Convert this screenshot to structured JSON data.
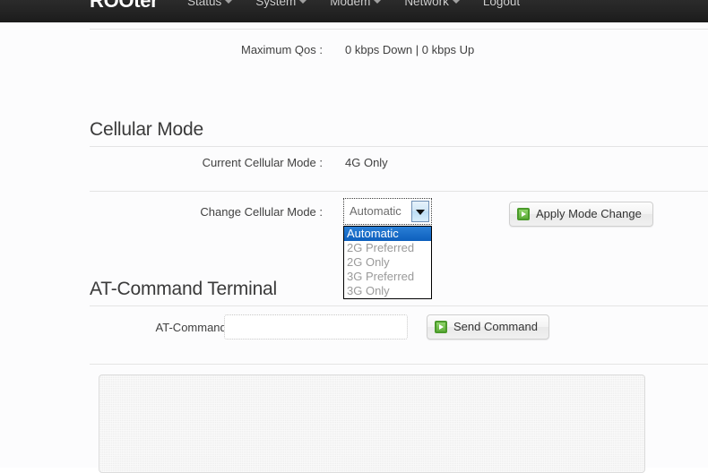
{
  "navbar": {
    "brand": "ROOter",
    "items": [
      {
        "label": "Status",
        "has_caret": true
      },
      {
        "label": "System",
        "has_caret": true
      },
      {
        "label": "Modem",
        "has_caret": true
      },
      {
        "label": "Network",
        "has_caret": true
      },
      {
        "label": "Logout",
        "has_caret": false
      }
    ]
  },
  "qos": {
    "label": "Maximum Qos :",
    "value": "0 kbps Down | 0 kbps Up"
  },
  "cellular": {
    "section_title": "Cellular Mode",
    "current_label": "Current Cellular Mode :",
    "current_value": "4G Only",
    "change_label": "Change Cellular Mode :",
    "select_value": "Automatic",
    "options": [
      "Automatic",
      "2G Preferred",
      "2G Only",
      "3G Preferred",
      "3G Only"
    ],
    "apply_button": "Apply Mode Change"
  },
  "terminal": {
    "section_title": "AT-Command Terminal",
    "command_label": "AT-Command :",
    "command_value": "",
    "command_placeholder": "",
    "send_button": "Send Command",
    "output_value": ""
  },
  "colors": {
    "navbar_bg": "#232323",
    "accent_select": "#1469c8",
    "icon_green": "#5fae3a",
    "text": "#404040"
  }
}
